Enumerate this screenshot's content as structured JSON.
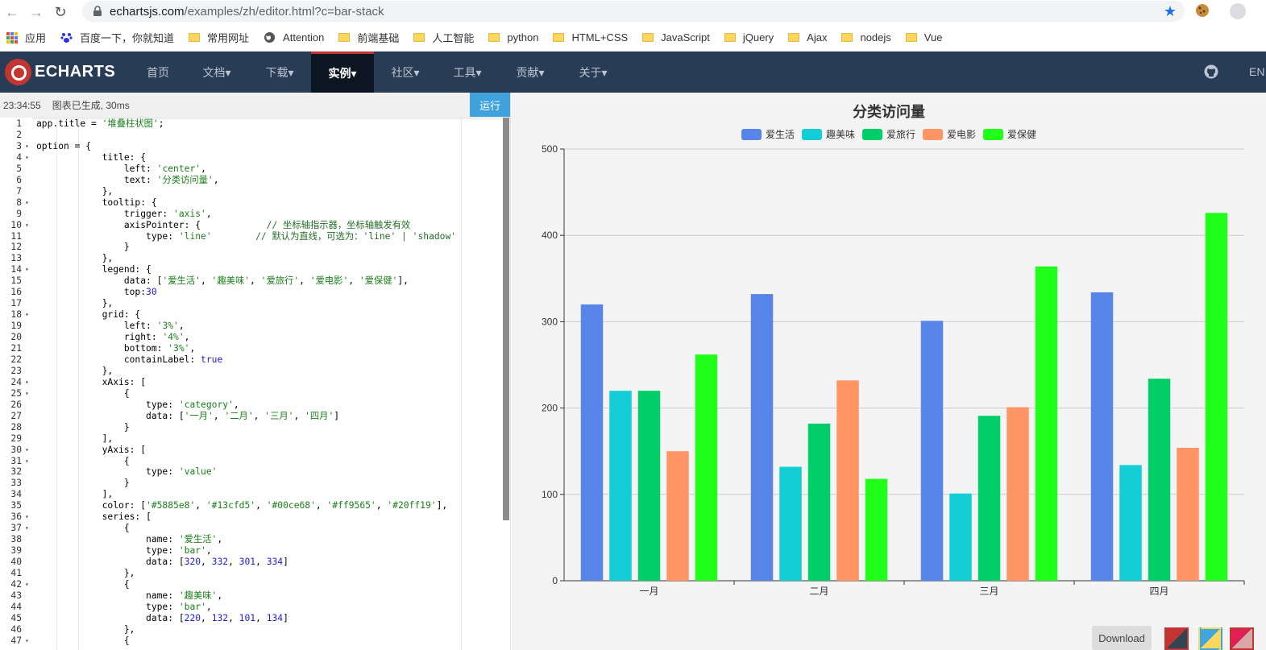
{
  "browser": {
    "url_host": "echartsjs.com",
    "url_path": "/examples/zh/editor.html?c=bar-stack",
    "bookmarks": [
      "应用",
      "百度一下，你就知道",
      "常用网址",
      "Attention",
      "前端基础",
      "人工智能",
      "python",
      "HTML+CSS",
      "JavaScript",
      "jQuery",
      "Ajax",
      "nodejs",
      "Vue"
    ]
  },
  "site_nav": {
    "logo": "ECHARTS",
    "items": [
      "首页",
      "文档▾",
      "下载▾",
      "实例▾",
      "社区▾",
      "工具▾",
      "贡献▾",
      "关于▾"
    ],
    "active_index": 3,
    "lang": "EN"
  },
  "editor": {
    "time": "23:34:55",
    "message": "图表已生成, 30ms",
    "run_label": "运行",
    "lines": [
      "app.title = '堆叠柱状图';",
      "",
      "option = {",
      "            title: {",
      "                left: 'center',",
      "                text: '分类访问量',",
      "            },",
      "            tooltip: {",
      "                trigger: 'axis',",
      "                axisPointer: {            // 坐标轴指示器，坐标轴触发有效",
      "                    type: 'line'        // 默认为直线，可选为：'line' | 'shadow'",
      "                }",
      "            },",
      "            legend: {",
      "                data: ['爱生活', '趣美味', '爱旅行', '爱电影', '爱保健'],",
      "                top:30",
      "            },",
      "            grid: {",
      "                left: '3%',",
      "                right: '4%',",
      "                bottom: '3%',",
      "                containLabel: true",
      "            },",
      "            xAxis: [",
      "                {",
      "                    type: 'category',",
      "                    data: ['一月', '二月', '三月', '四月']",
      "                }",
      "            ],",
      "            yAxis: [",
      "                {",
      "                    type: 'value'",
      "                }",
      "            ],",
      "            color: ['#5885e8', '#13cfd5', '#00ce68', '#ff9565', '#20ff19'],",
      "            series: [",
      "                {",
      "                    name: '爱生活',",
      "                    type: 'bar',",
      "                    data: [320, 332, 301, 334]",
      "                },",
      "                {",
      "                    name: '趣美味',",
      "                    type: 'bar',",
      "                    data: [220, 132, 101, 134]",
      "                },",
      "                {"
    ],
    "fold_lines": [
      3,
      4,
      8,
      10,
      14,
      18,
      24,
      25,
      30,
      31,
      36,
      37,
      42,
      47
    ]
  },
  "chart_data": {
    "type": "bar",
    "title": "分类访问量",
    "categories": [
      "一月",
      "二月",
      "三月",
      "四月"
    ],
    "series": [
      {
        "name": "爱生活",
        "color": "#5885e8",
        "values": [
          320,
          332,
          301,
          334
        ]
      },
      {
        "name": "趣美味",
        "color": "#13cfd5",
        "values": [
          220,
          132,
          101,
          134
        ]
      },
      {
        "name": "爱旅行",
        "color": "#00ce68",
        "values": [
          220,
          182,
          191,
          234
        ]
      },
      {
        "name": "爱电影",
        "color": "#ff9565",
        "values": [
          150,
          232,
          201,
          154
        ]
      },
      {
        "name": "爱保健",
        "color": "#20ff19",
        "values": [
          262,
          118,
          364,
          426
        ]
      }
    ],
    "ylim": [
      0,
      500
    ],
    "yticks": [
      0,
      100,
      200,
      300,
      400,
      500
    ],
    "grid": true,
    "legend_position": "top-center"
  },
  "chart_panel": {
    "download_label": "Download"
  }
}
